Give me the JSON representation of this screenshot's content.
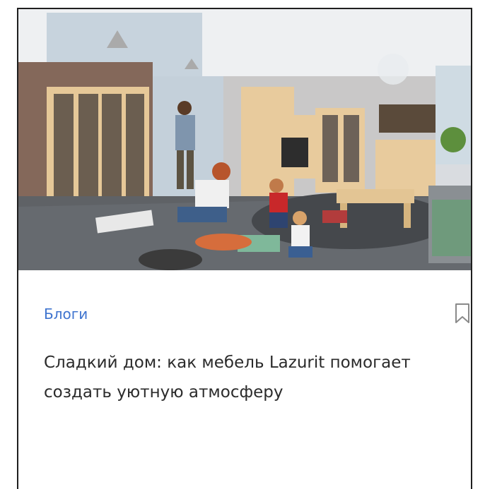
{
  "card": {
    "category": "Блоги",
    "title": "Сладкий дом: как мебель Lazurit помогает создать уютную атмосферу",
    "image_alt": "living room with family",
    "bookmark_icon": "bookmark-icon"
  },
  "colors": {
    "category": "#3f74cf",
    "title": "#2b2b2b",
    "border": "#1f1f1f",
    "icon": "#8a8a8a"
  }
}
